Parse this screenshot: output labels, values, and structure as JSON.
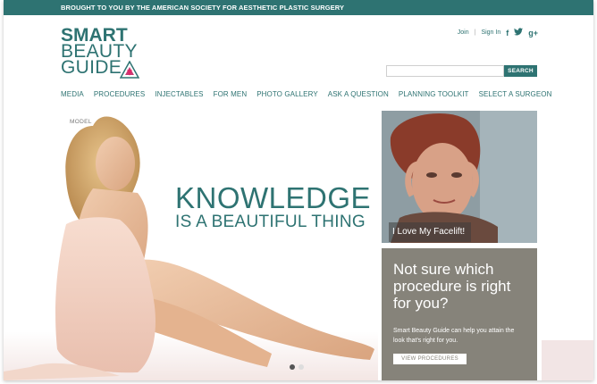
{
  "topbar": {
    "text": "BROUGHT TO YOU BY THE AMERICAN SOCIETY FOR AESTHETIC PLASTIC SURGERY"
  },
  "logo": {
    "line1": "SMART",
    "line2": "BEAUTY",
    "line3": "GUIDE"
  },
  "util": {
    "join": "Join",
    "sign_in": "Sign In",
    "facebook": "f",
    "twitter": "t",
    "gplus": "g+"
  },
  "search": {
    "placeholder": "",
    "button": "SEARCH"
  },
  "nav": [
    "MEDIA",
    "PROCEDURES",
    "INJECTABLES",
    "FOR MEN",
    "PHOTO GALLERY",
    "ASK A QUESTION",
    "PLANNING TOOLKIT",
    "SELECT A SURGEON"
  ],
  "hero": {
    "model_label": "MODEL",
    "headline": "KNOWLEDGE",
    "subheadline": "IS A BEAUTIFUL THING",
    "slide_count": 2,
    "active_slide": 1
  },
  "promo": {
    "caption": "I Love My Facelift!"
  },
  "card": {
    "question": "Not sure which procedure is right for you?",
    "body": "Smart Beauty Guide can help you attain the look that's right for you.",
    "button": "VIEW PROCEDURES"
  },
  "colors": {
    "brand": "#2e7372",
    "card": "#86837a"
  }
}
